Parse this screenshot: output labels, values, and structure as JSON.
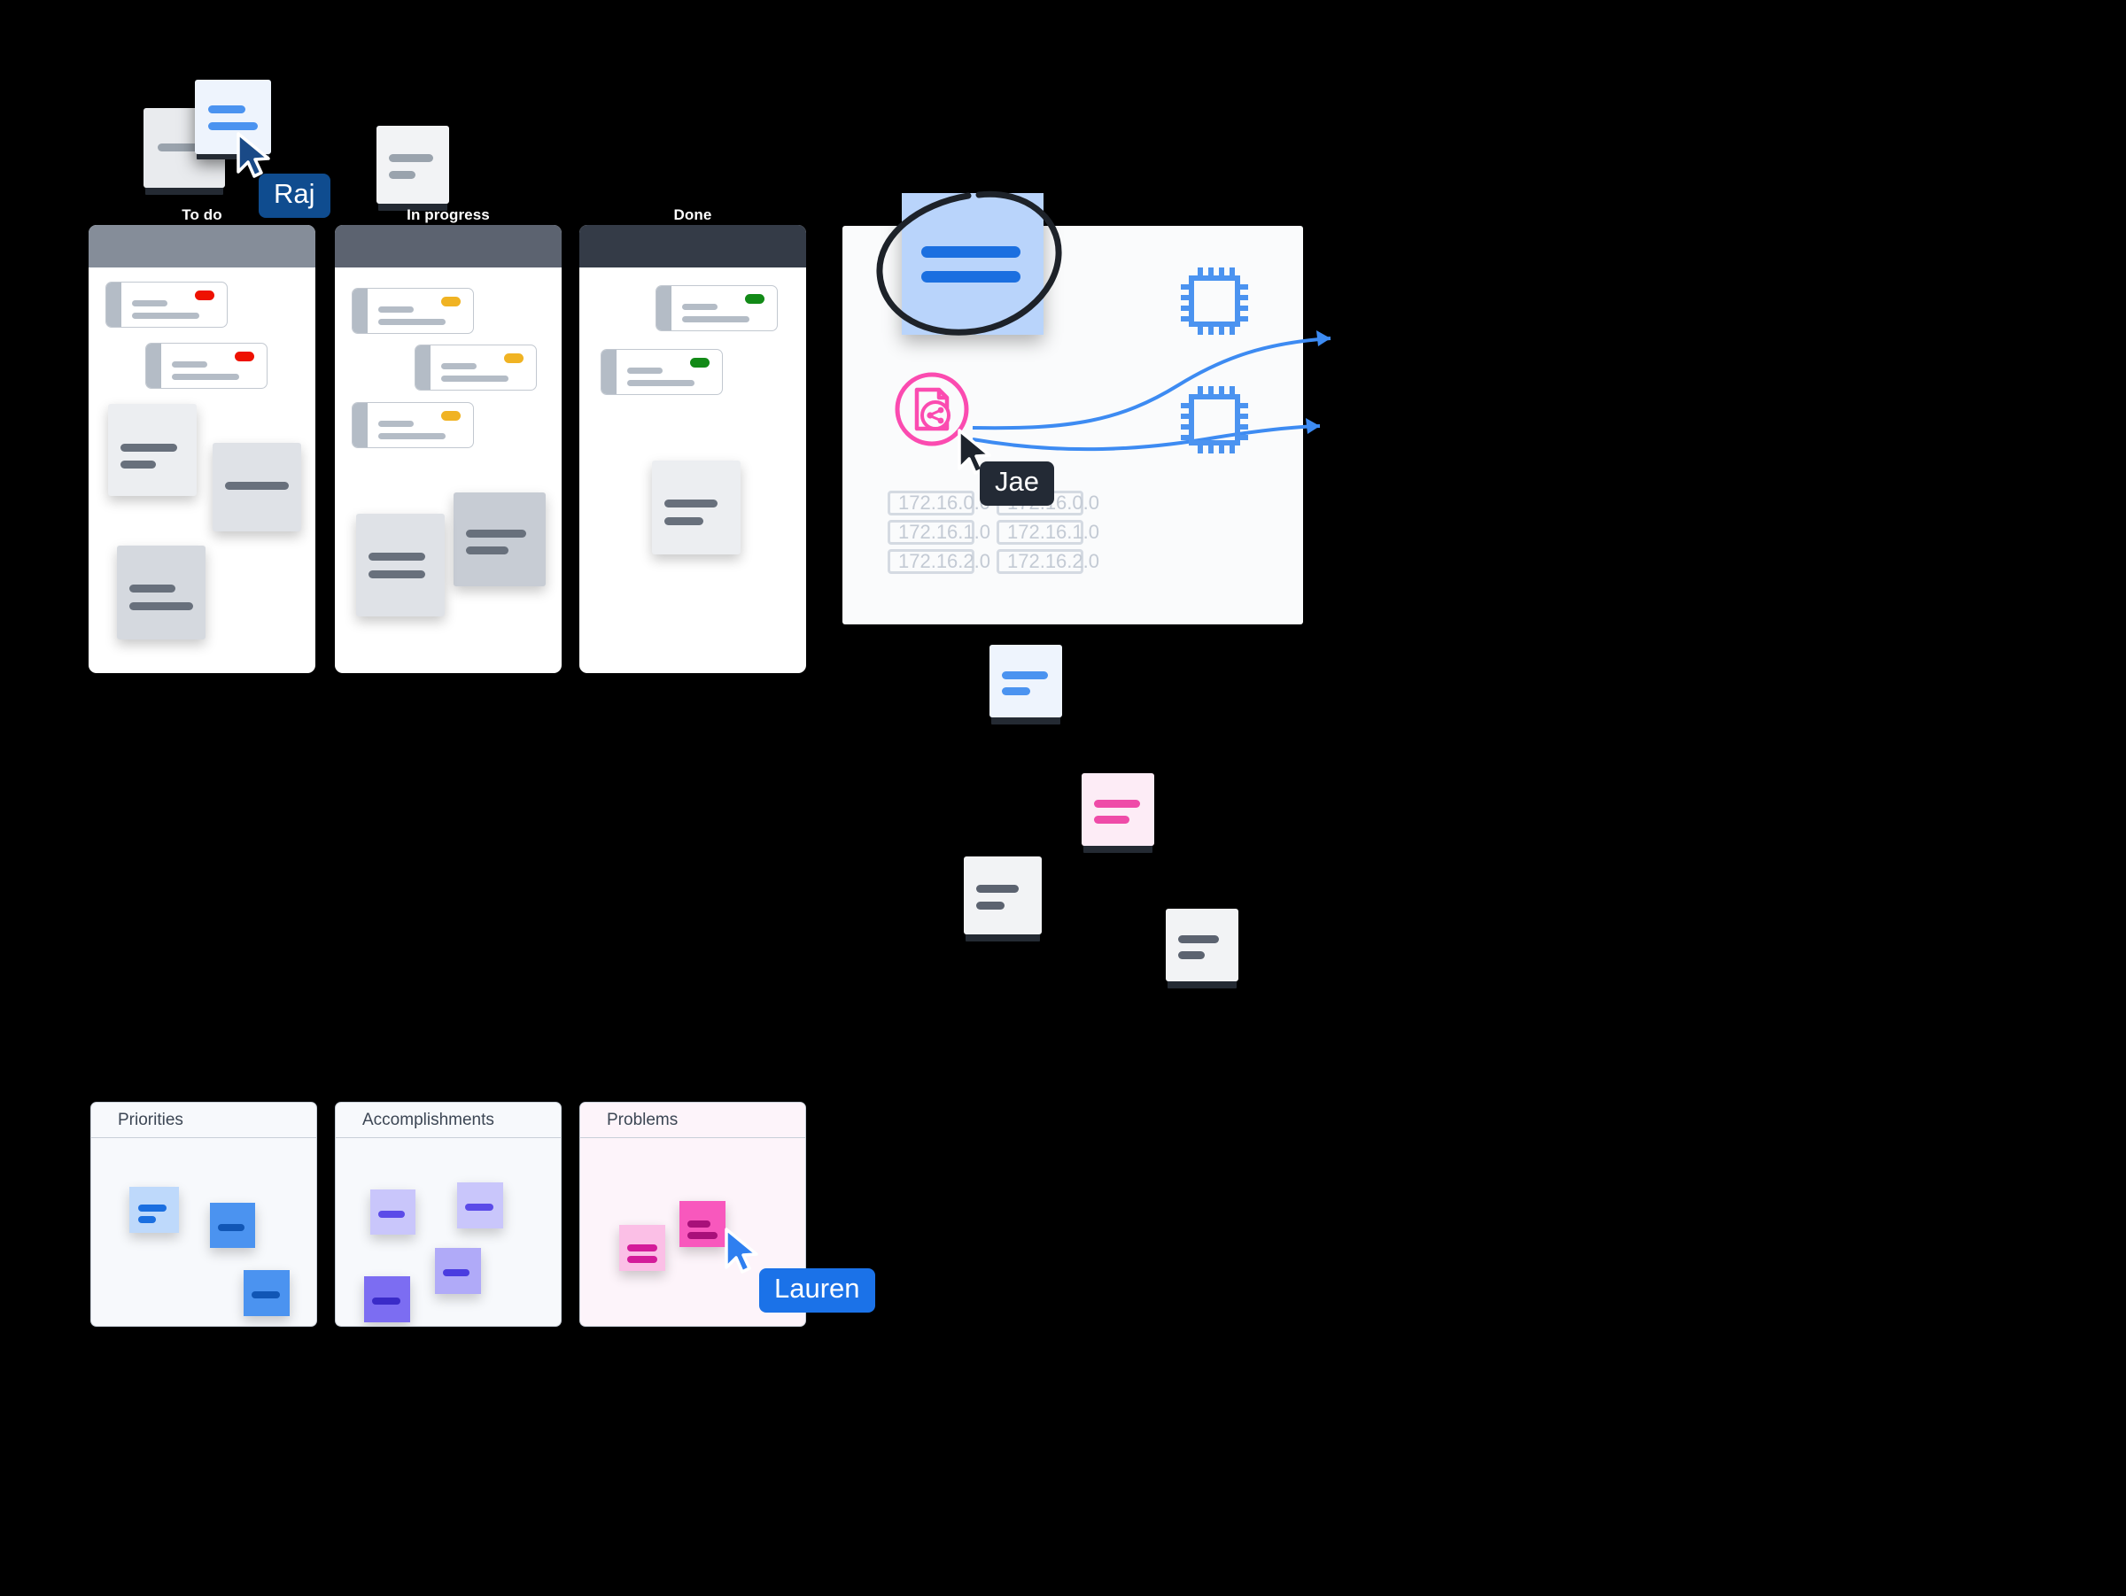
{
  "canvas": {
    "background": "#000000"
  },
  "kanban": {
    "columns": [
      {
        "label": "To do",
        "header_color": "#858d99",
        "cards": [
          {
            "status_color": "#ee1100",
            "status_name": "red-status-dot"
          },
          {
            "status_color": "#ee1100",
            "status_name": "red-status-dot"
          }
        ]
      },
      {
        "label": "In progress",
        "header_color": "#5c6370",
        "cards": [
          {
            "status_color": "#f0b323",
            "status_name": "amber-status-dot"
          },
          {
            "status_color": "#f0b323",
            "status_name": "amber-status-dot"
          },
          {
            "status_color": "#f0b323",
            "status_name": "amber-status-dot"
          }
        ]
      },
      {
        "label": "Done",
        "header_color": "#343b47",
        "cards": [
          {
            "status_color": "#128a17",
            "status_name": "green-status-dot"
          },
          {
            "status_color": "#128a17",
            "status_name": "green-status-dot"
          }
        ]
      }
    ]
  },
  "whiteboard": {
    "sticky_color": "#b9d4fb",
    "ink_annotation": "ellipse-circle-highlight",
    "share_icon": {
      "name": "share-document-icon",
      "color": "#fb4bb0"
    },
    "chips": [
      {
        "name": "cpu-chip-icon",
        "color": "#4b93f0"
      },
      {
        "name": "cpu-chip-icon",
        "color": "#4b93f0"
      }
    ],
    "arrows": [
      {
        "name": "curved-arrow-to-top-chip",
        "color": "#3d8bf2"
      },
      {
        "name": "curved-arrow-to-bottom-chip",
        "color": "#3d8bf2"
      }
    ],
    "ip_fields_left": [
      "172.16.0.0",
      "172.16.1.0",
      "172.16.2.0"
    ],
    "ip_fields_right": [
      "172.16.0.0",
      "172.16.1.0",
      "172.16.2.0"
    ]
  },
  "retro_boards": [
    {
      "title": "Priorities",
      "notes": [
        {
          "bg": "#bed9fb",
          "line": "#1b6fe0",
          "lines": 2
        },
        {
          "bg": "#4b93f0",
          "line": "#1156b5",
          "lines": 1
        },
        {
          "bg": "#4b93f0",
          "line": "#1156b5",
          "lines": 1
        }
      ]
    },
    {
      "title": "Accomplishments",
      "notes": [
        {
          "bg": "#c9c6fb",
          "line": "#5b4be8",
          "lines": 1
        },
        {
          "bg": "#c9c6fb",
          "line": "#5b4be8",
          "lines": 1
        },
        {
          "bg": "#b0aaf8",
          "line": "#4a3ce0",
          "lines": 1
        },
        {
          "bg": "#7c6df2",
          "line": "#3a2bc8",
          "lines": 1
        }
      ]
    },
    {
      "title": "Problems",
      "notes": [
        {
          "bg": "#fbbfe6",
          "line": "#d41b9a",
          "lines": 2
        },
        {
          "bg": "#f858bd",
          "line": "#a8107a",
          "lines": 2
        }
      ]
    }
  ],
  "cursors": [
    {
      "name": "Raj",
      "tag_bg": "#0f4c8f",
      "pointer_color": "#1a4a87"
    },
    {
      "name": "Jae",
      "tag_bg": "#232a35",
      "pointer_color": "#1d232c"
    },
    {
      "name": "Lauren",
      "tag_bg": "#1b72e8",
      "pointer_color": "#2f7ff0"
    }
  ]
}
